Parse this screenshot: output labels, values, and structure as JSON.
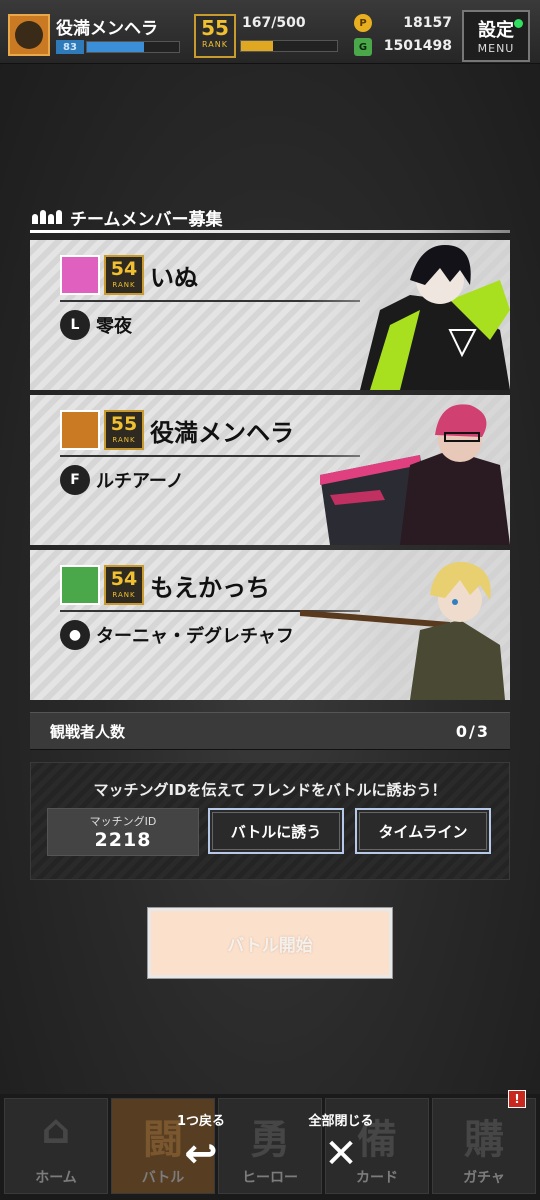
{
  "player": {
    "name": "役満メンヘラ",
    "level": "83",
    "exp_progress": 0.62,
    "rank": "55",
    "rank_label": "RANK",
    "stamina": "167/500",
    "stamina_progress": 0.334,
    "coin_icon": "P",
    "coins": "18157",
    "gem_icon": "G",
    "gems": "1501498"
  },
  "menu": {
    "kanji": "設定",
    "label": "MENU"
  },
  "team": {
    "title": "チームメンバー募集",
    "members": [
      {
        "name": "いぬ",
        "rank": "54",
        "rank_label": "RANK",
        "hero_icon": "L",
        "hero": "零夜",
        "emblem_color": "#e060c0"
      },
      {
        "name": "役満メンヘラ",
        "rank": "55",
        "rank_label": "RANK",
        "hero_icon": "F",
        "hero": "ルチアーノ",
        "emblem_color": "#c97a22"
      },
      {
        "name": "もえかっち",
        "rank": "54",
        "rank_label": "RANK",
        "hero_icon": "●",
        "hero": "ターニャ・デグレチャフ",
        "emblem_color": "#4aa84a"
      }
    ]
  },
  "spectators": {
    "label": "観戦者人数",
    "count": "0/3"
  },
  "invite": {
    "text": "マッチングIDを伝えて フレンドをバトルに誘おう！",
    "match_id_label": "マッチングID",
    "match_id": "2218",
    "battle_invite": "バトルに誘う",
    "timeline": "タイムライン"
  },
  "start_button": "バトル開始",
  "nav": [
    {
      "label": "ホーム",
      "kanji": "⌂"
    },
    {
      "label": "バトル",
      "kanji": "闘"
    },
    {
      "label": "ヒーロー",
      "kanji": "勇"
    },
    {
      "label": "カード",
      "kanji": "備"
    },
    {
      "label": "ガチャ",
      "kanji": "購"
    }
  ],
  "overlay_actions": {
    "back_label": "1つ戻る",
    "back_icon": "↩",
    "close_label": "全部閉じる",
    "close_icon": "✕"
  },
  "notification_badge": "!"
}
